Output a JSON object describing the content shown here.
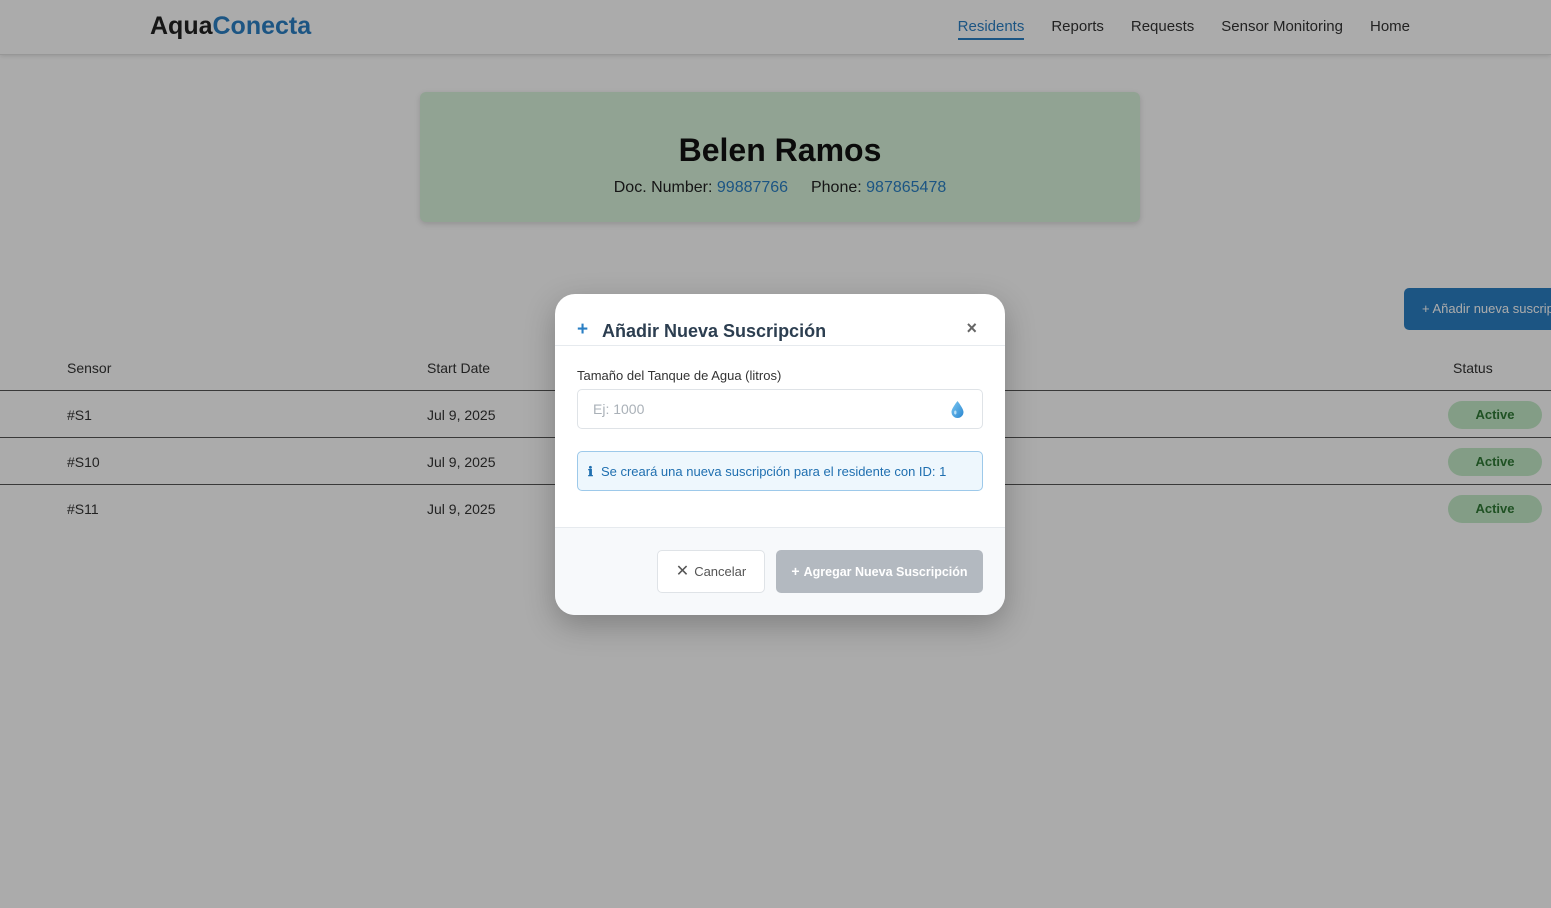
{
  "app": {
    "logo_part1": "Aqua",
    "logo_part2": "Conecta"
  },
  "nav": {
    "items": [
      "Residents",
      "Reports",
      "Requests",
      "Sensor Monitoring",
      "Home"
    ],
    "active": "Residents"
  },
  "resident": {
    "name": "Belen Ramos",
    "doc_label": "Doc. Number:",
    "doc_value": "99887766",
    "phone_label": "Phone:",
    "phone_value": "987865478"
  },
  "add_subscription_button": {
    "icon": "+",
    "label": "Añadir nueva suscripción"
  },
  "table": {
    "headers": {
      "sensor": "Sensor",
      "start_date": "Start Date",
      "status": "Status"
    },
    "rows": [
      {
        "sensor": "#S1",
        "start_date": "Jul 9, 2025",
        "status": "Active"
      },
      {
        "sensor": "#S10",
        "start_date": "Jul 9, 2025",
        "status": "Active"
      },
      {
        "sensor": "#S11",
        "start_date": "Jul 9, 2025",
        "status": "Active"
      }
    ]
  },
  "modal": {
    "title_icon": "+",
    "title": "Añadir Nueva Suscripción",
    "close_icon": "×",
    "field_label": "Tamaño del Tanque de Agua (litros)",
    "field_placeholder": "Ej: 1000",
    "field_value": "",
    "field_icon": "water-drop-icon",
    "info_icon": "ℹ",
    "info_text": "Se creará una nueva suscripción para el residente con ID: 1",
    "cancel_icon": "✕",
    "cancel_label": "Cancelar",
    "submit_icon": "+",
    "submit_label": "Agregar Nueva Suscripción"
  },
  "colors": {
    "brand_blue": "#2a7fc4",
    "card_bg": "#d8f3dc",
    "badge_bg": "#c3ebc8",
    "badge_text": "#2f7a35",
    "submit_disabled": "#b3b9c0"
  }
}
